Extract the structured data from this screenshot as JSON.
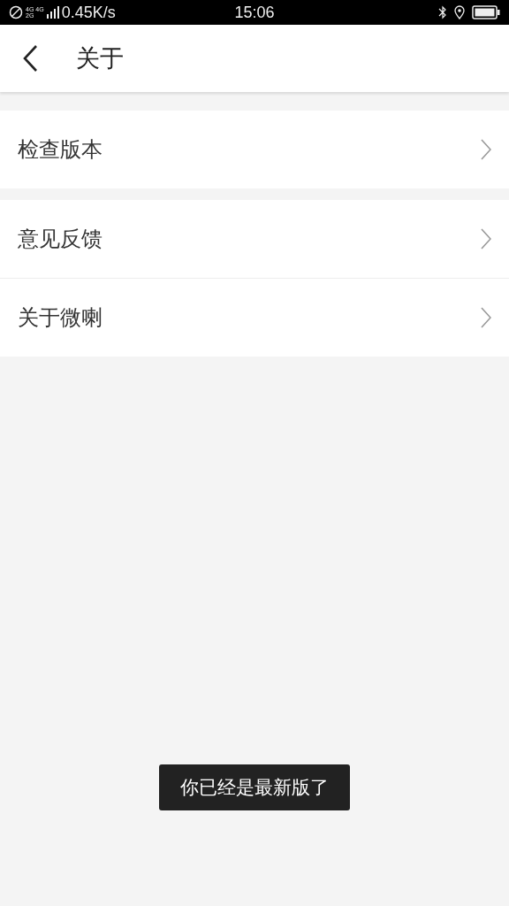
{
  "status_bar": {
    "network_labels": [
      "4G",
      "4G",
      "2G"
    ],
    "speed": "0.45K/s",
    "time": "15:06"
  },
  "header": {
    "title": "关于"
  },
  "groups": [
    {
      "items": [
        {
          "label": "检查版本"
        }
      ]
    },
    {
      "items": [
        {
          "label": "意见反馈"
        },
        {
          "label": "关于微喇"
        }
      ]
    }
  ],
  "toast": "你已经是最新版了"
}
